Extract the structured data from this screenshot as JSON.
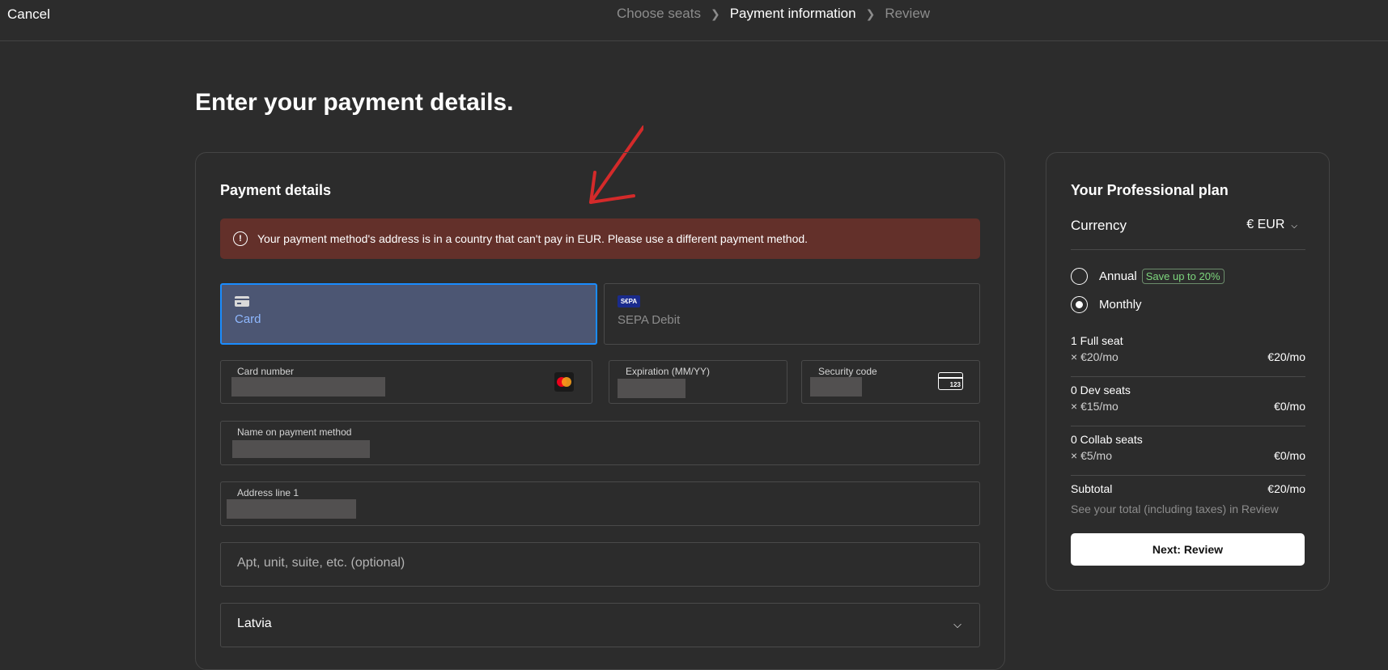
{
  "header": {
    "cancel_label": "Cancel",
    "steps": [
      "Choose seats",
      "Payment information",
      "Review"
    ],
    "active_step": "Payment information"
  },
  "page_title": "Enter your payment details.",
  "payment": {
    "section_title": "Payment details",
    "error_message": "Your payment method's address is in a country that can't pay in EUR. Please use a different payment method.",
    "methods": {
      "card_label": "Card",
      "sepa_label": "SEPA Debit",
      "sepa_icon_text": "S€PA",
      "selected": "Card"
    },
    "fields": {
      "card_number_label": "Card number",
      "expiration_label": "Expiration (MM/YY)",
      "security_code_label": "Security code",
      "cvc_icon_text": "123",
      "name_label": "Name on payment method",
      "address1_label": "Address line 1",
      "address2_placeholder": "Apt, unit, suite, etc. (optional)",
      "country_value": "Latvia"
    }
  },
  "plan": {
    "title": "Your Professional plan",
    "currency_label": "Currency",
    "currency_value": "€ EUR",
    "billing": {
      "annual_label": "Annual",
      "annual_badge": "Save up to 20%",
      "monthly_label": "Monthly",
      "selected": "Monthly"
    },
    "seats": [
      {
        "name": "1 Full seat",
        "rate": "× €20/mo",
        "amount": "€20/mo"
      },
      {
        "name": "0 Dev seats",
        "rate": "× €15/mo",
        "amount": "€0/mo"
      },
      {
        "name": "0 Collab seats",
        "rate": "× €5/mo",
        "amount": "€0/mo"
      }
    ],
    "subtotal_label": "Subtotal",
    "subtotal_value": "€20/mo",
    "total_note": "See your total (including taxes) in Review",
    "next_button": "Next: Review"
  },
  "colors": {
    "background": "#2c2c2c",
    "error_banner": "#63302a",
    "selected_method_bg": "#4c5673",
    "selected_method_border": "#1a8cff",
    "save_badge": "#7dd67d",
    "annotation_arrow": "#d42a2a"
  }
}
